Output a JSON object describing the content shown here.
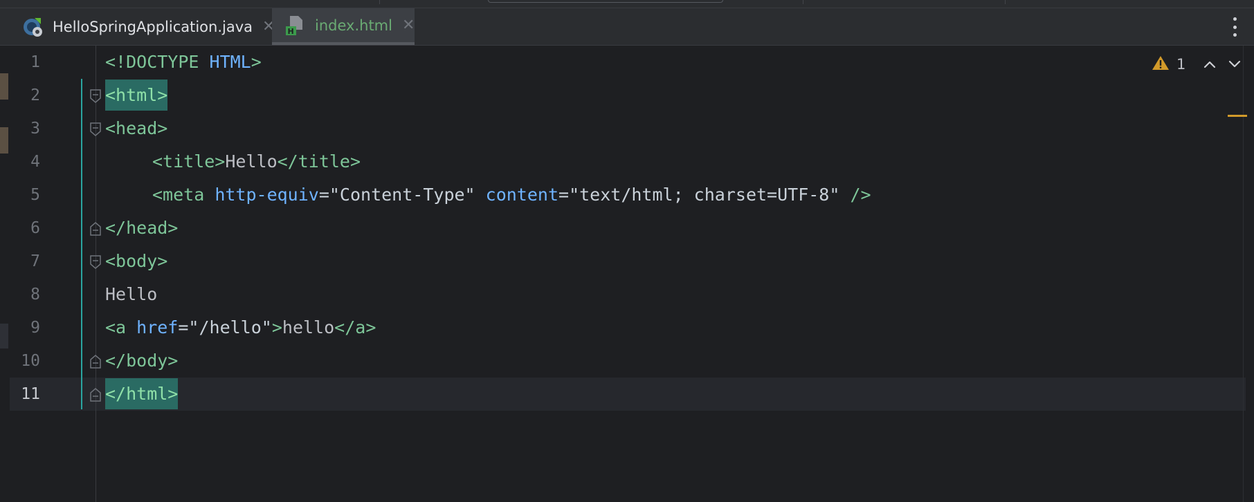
{
  "tabs": [
    {
      "label": "HelloSpringApplication.java",
      "active": false,
      "icon": "spring-boot-java-icon"
    },
    {
      "label": "index.html",
      "active": true,
      "icon": "html-file-icon"
    }
  ],
  "editor": {
    "current_line": 11,
    "inspections": {
      "warnings": "1"
    },
    "lines": [
      {
        "n": "1"
      },
      {
        "n": "2"
      },
      {
        "n": "3"
      },
      {
        "n": "4"
      },
      {
        "n": "5"
      },
      {
        "n": "6"
      },
      {
        "n": "7"
      },
      {
        "n": "8"
      },
      {
        "n": "9"
      },
      {
        "n": "10"
      },
      {
        "n": "11"
      }
    ],
    "code": {
      "l1": {
        "a": "<!DOCTYPE ",
        "b": "HTML",
        "c": ">"
      },
      "l2": {
        "a": "<html>"
      },
      "l3": {
        "a": "<head>"
      },
      "l4": {
        "a": "<title>",
        "b": "Hello",
        "c": "</title>"
      },
      "l5": {
        "a": "<meta ",
        "b": "http-equiv",
        "c": "=\"Content-Type\" ",
        "d": "content",
        "e": "=\"text/html; charset=UTF-8\" ",
        "f": "/>"
      },
      "l6": {
        "a": "</head>"
      },
      "l7": {
        "a": "<body>"
      },
      "l8": {
        "a": "Hello"
      },
      "l9": {
        "a": "<a ",
        "b": "href",
        "c": "=\"/hello\"",
        "d": ">",
        "e": "hello",
        "f": "</a>"
      },
      "l10": {
        "a": "</body>"
      },
      "l11": {
        "a": "</html>"
      }
    }
  },
  "colors": {
    "tag": "#7ec699",
    "attribute": "#6fb3ff",
    "matched_tag_bg": "#2a6b63",
    "warning": "#d29a2a",
    "active_tab_text": "#6aab73"
  }
}
